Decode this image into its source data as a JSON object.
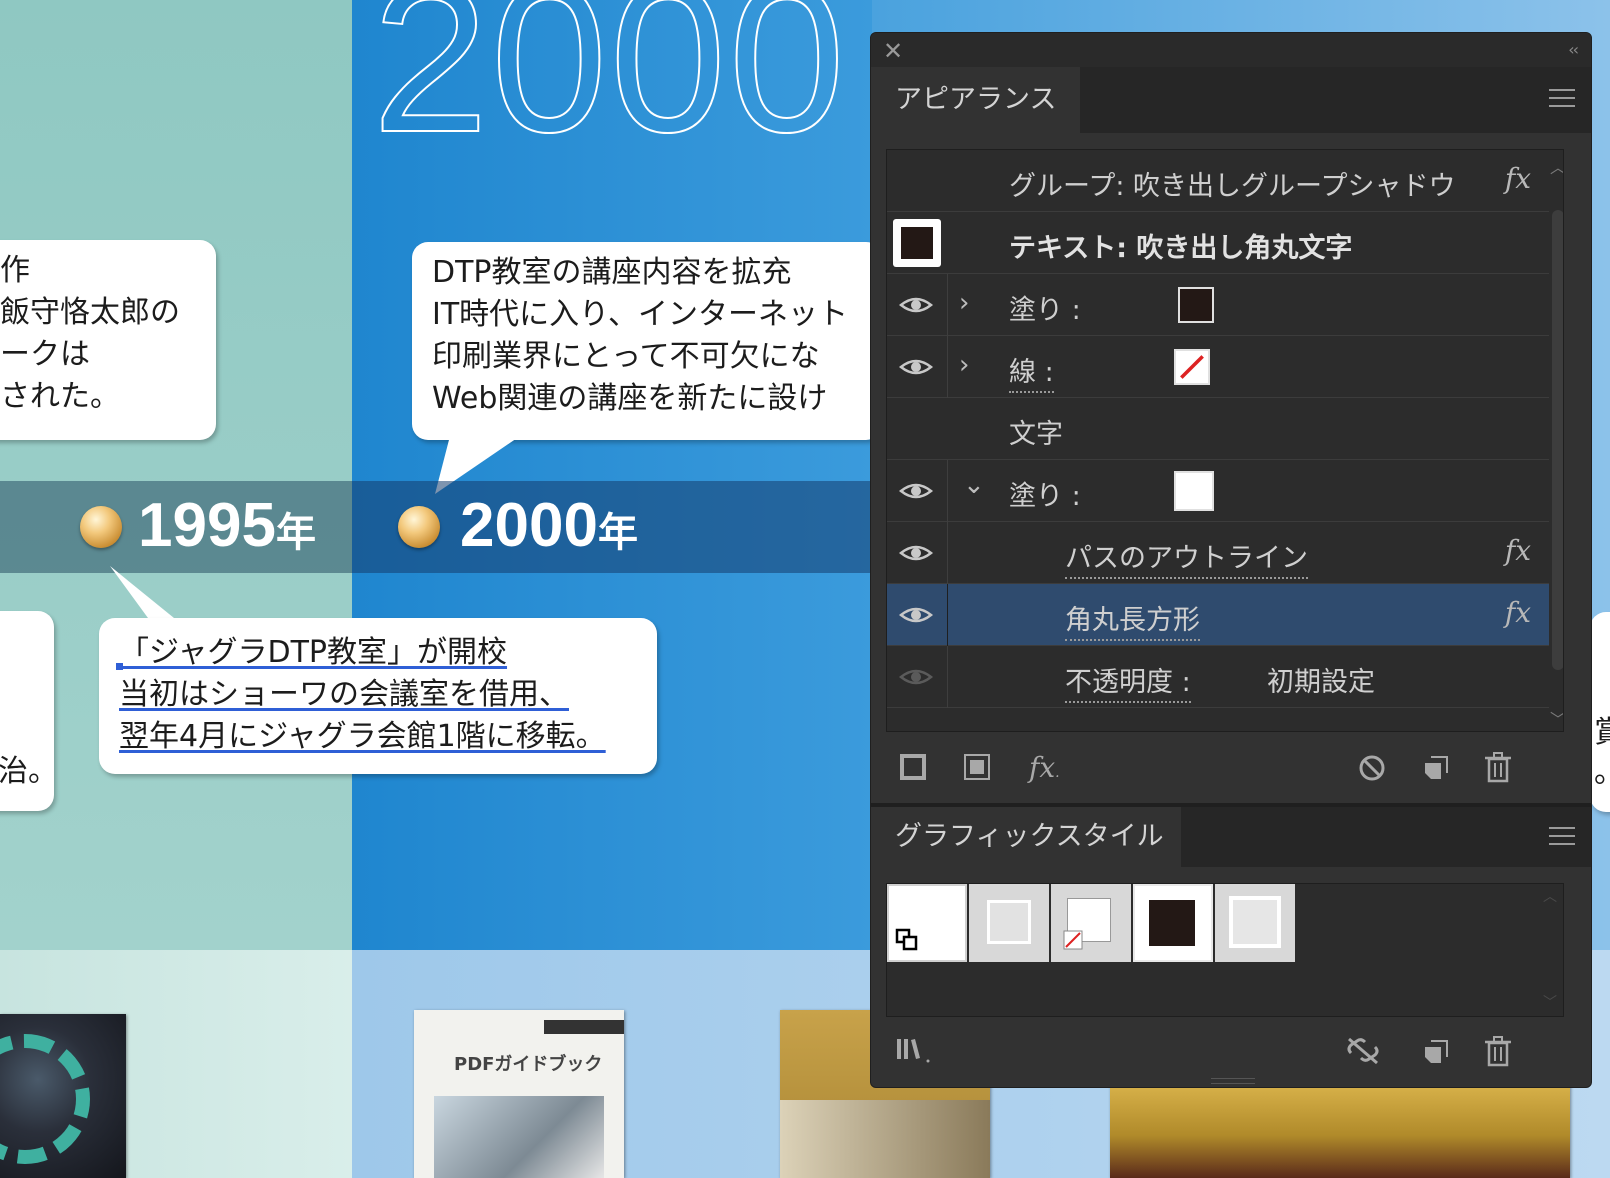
{
  "artboard": {
    "big_year": "2000",
    "bubble_left_top": [
      "作",
      "飯守恪太郎の",
      "ークは",
      "された。"
    ],
    "bubble_2000": [
      "DTP教室の講座内容を拡充",
      "IT時代に入り、インターネット",
      "印刷業界にとって不可欠にな",
      "Web関連の講座を新たに設け"
    ],
    "timeline_1995": "1995",
    "timeline_2000": "2000",
    "timeline_nen": "年",
    "bubble_left_bottom": "治。",
    "bubble_1995": [
      "「ジャグラDTP教室」が開校",
      "当初はショーワの会議室を借用、",
      "翌年4月にジャグラ会館1階に移転。"
    ],
    "right_edge_text": [
      "賞",
      "。"
    ],
    "book_title": "PDFガイドブック"
  },
  "panel": {
    "appearance_tab": "アピアランス",
    "rows": {
      "group": "グループ: 吹き出しグループシャドウ",
      "text_object": "テキスト: 吹き出し角丸文字",
      "fill_1": "塗り :",
      "stroke": "線 :",
      "characters": "文字",
      "fill_2": "塗り :",
      "effect_outline": "パスのアウトライン",
      "effect_rounded": "角丸長方形",
      "opacity": "不透明度 :",
      "opacity_value": "初期設定"
    },
    "fx_label": "fx",
    "graphic_styles_tab": "グラフィックスタイル"
  },
  "colors": {
    "panel_bg": "#323232",
    "selected_row": "#2f4b6e",
    "accent_underline": "#2f5fd6"
  }
}
